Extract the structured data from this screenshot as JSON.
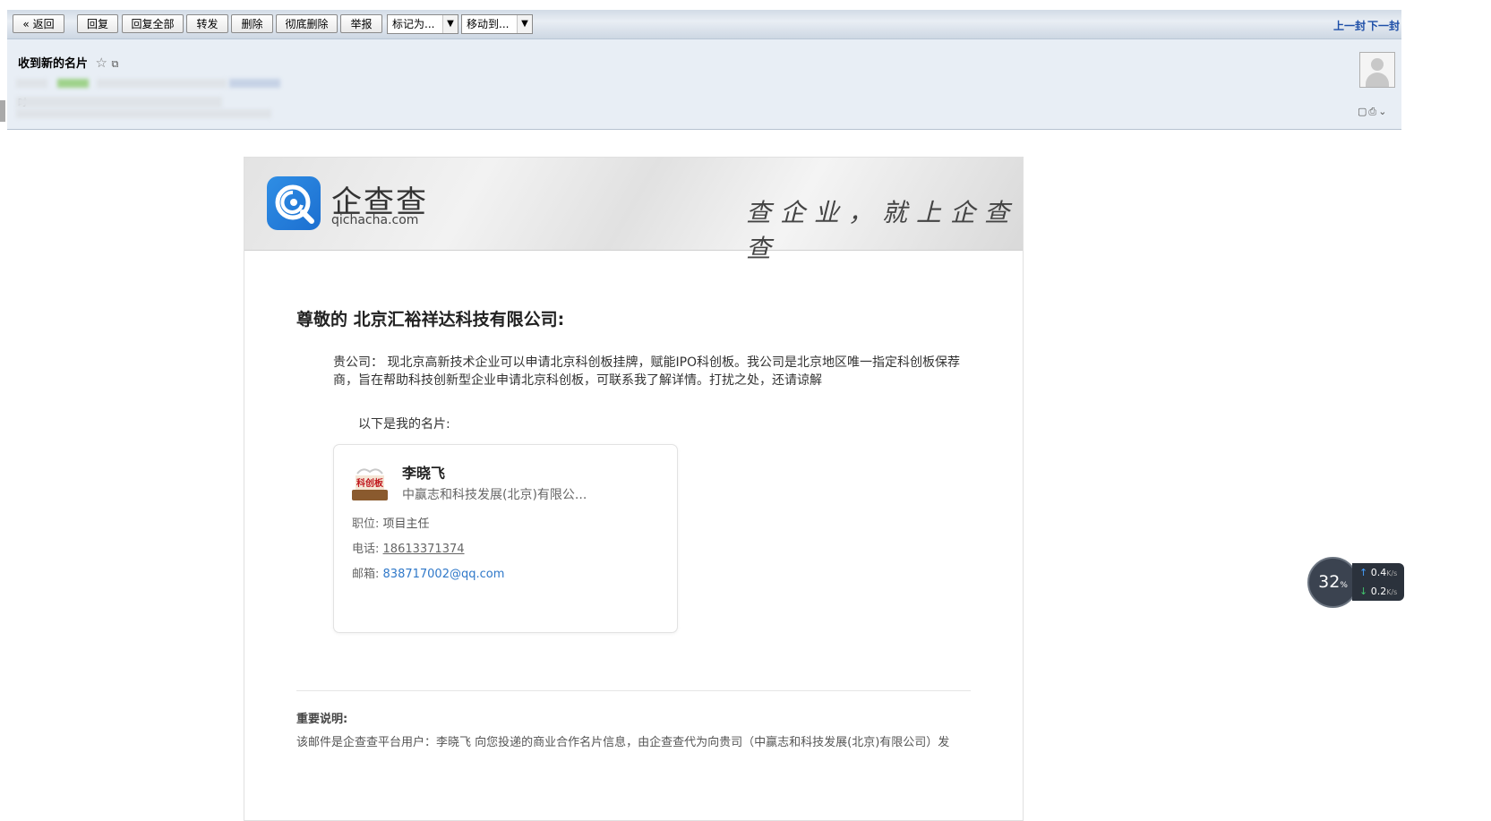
{
  "toolbar": {
    "back": "« 返回",
    "reply": "回复",
    "reply_all": "回复全部",
    "forward": "转发",
    "delete": "删除",
    "perm_delete": "彻底删除",
    "report": "举报",
    "mark_as": "标记为...",
    "move_to": "移动到...",
    "prev": "上一封",
    "next": "下一封"
  },
  "header": {
    "subject": "收到新的名片",
    "time_label": "时"
  },
  "banner": {
    "logo_cn": "企查查",
    "logo_en": "qichacha.com",
    "slogan": "查企业，就上企查查"
  },
  "body": {
    "greeting": "尊敬的 北京汇裕祥达科技有限公司:",
    "paragraph": "贵公司： 现北京高新技术企业可以申请北京科创板挂牌，赋能IPO科创板。我公司是北京地区唯一指定科创板保荐商，旨在帮助科技创新型企业申请北京科创板，可联系我了解详情。打扰之处，还请谅解",
    "card_intro": "以下是我的名片:"
  },
  "card": {
    "logo_text": "科创板",
    "name": "李晓飞",
    "company": "中赢志和科技发展(北京)有限公...",
    "title_label": "职位:",
    "title_value": "项目主任",
    "phone_label": "电话:",
    "phone_value": "18613371374",
    "email_label": "邮箱:",
    "email_value": "838717002@qq.com"
  },
  "notice": {
    "title": "重要说明:",
    "text": "该邮件是企查查平台用户：李晓飞 向您投递的商业合作名片信息，由企查查代为向贵司（中赢志和科技发展(北京)有限公司）发"
  },
  "widget": {
    "percent": "32",
    "percent_unit": "%",
    "up_speed": "0.4",
    "down_speed": "0.2",
    "speed_unit": "K/s"
  }
}
